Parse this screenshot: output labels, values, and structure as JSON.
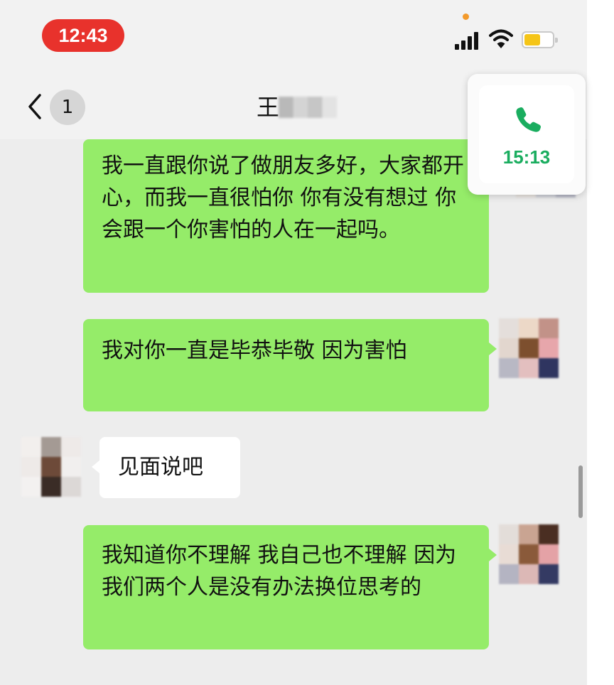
{
  "status_bar": {
    "time": "12:43",
    "time_pill_color": "#e8322c",
    "icons": [
      "cellular-signal-icon",
      "wifi-icon",
      "battery-icon"
    ],
    "battery_level": 0.45
  },
  "nav": {
    "back_icon": "chevron-left-icon",
    "unread_count": "1",
    "contact_name": "王"
  },
  "call_card": {
    "icon": "phone-icon",
    "duration": "15:13",
    "accent_color": "#1aad5f"
  },
  "messages": [
    {
      "direction": "outgoing",
      "text": "我一直跟你说了做朋友多好，大家都开心，而我一直很怕你 你有没有想过 你会跟一个你害怕的人在一起吗。"
    },
    {
      "direction": "outgoing",
      "text": "我对你一直是毕恭毕敬 因为害怕"
    },
    {
      "direction": "incoming",
      "text": "见面说吧"
    },
    {
      "direction": "outgoing",
      "text": "我知道你不理解 我自己也不理解 因为我们两个人是没有办法换位思考的"
    }
  ],
  "colors": {
    "outgoing_bubble": "#95ec69",
    "incoming_bubble": "#ffffff",
    "chat_background": "#ededed"
  }
}
